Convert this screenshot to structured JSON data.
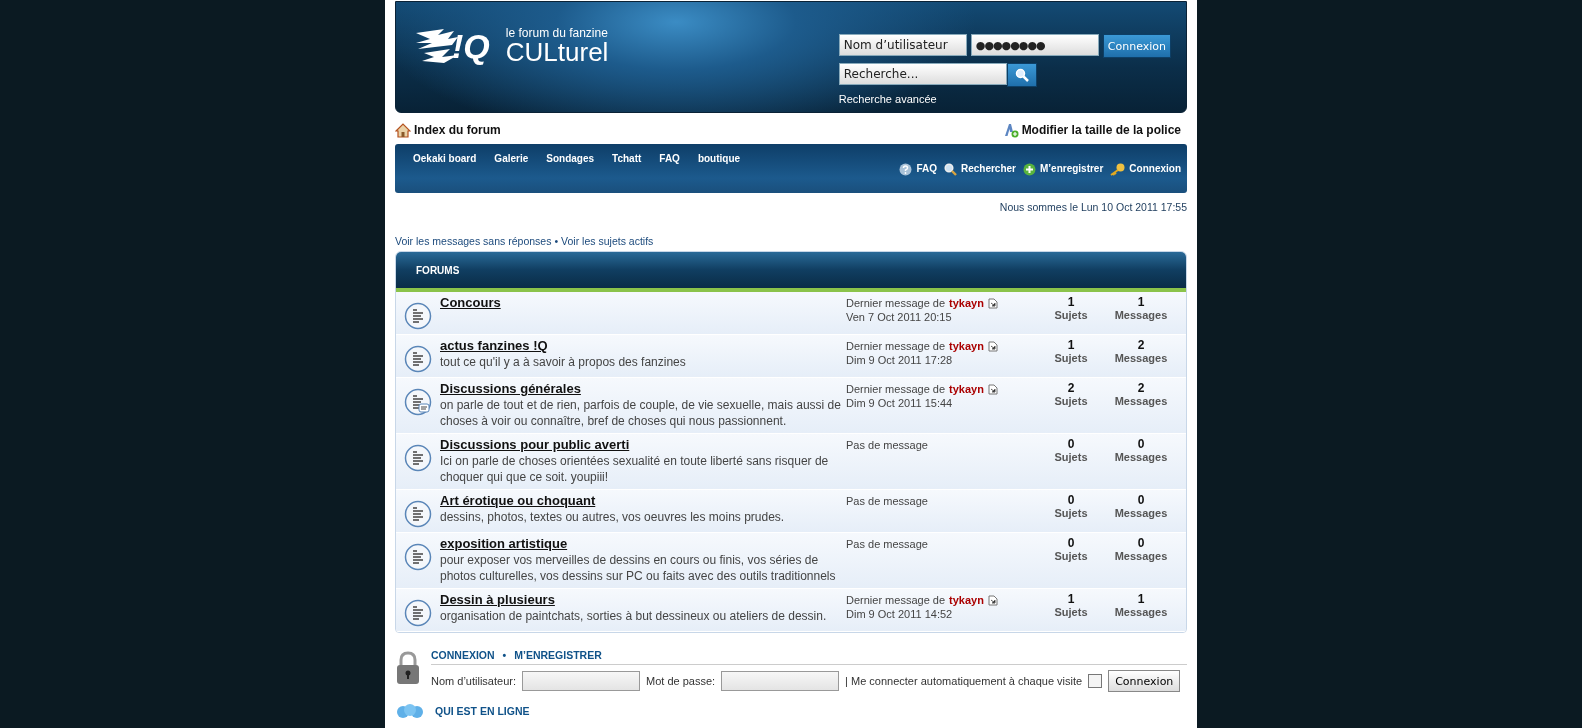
{
  "header": {
    "logo_mark": "!Q",
    "tagline": "le forum du fanzine",
    "site_name": "CULturel",
    "login": {
      "username_placeholder": "Nom d’utilisateur",
      "password_value": "●●●●●●●●",
      "button": "Connexion"
    },
    "search": {
      "placeholder": "Recherche...",
      "advanced_link": "Recherche avancée"
    }
  },
  "breadcrumb": {
    "index": "Index du forum",
    "font_size": "Modifier la taille de la police"
  },
  "navbar": {
    "links": [
      "Oekaki board",
      "Galerie",
      "Sondages",
      "Tchatt",
      "FAQ",
      "boutique"
    ],
    "actions": [
      {
        "kind": "help",
        "label": "FAQ"
      },
      {
        "kind": "search",
        "label": "Rechercher"
      },
      {
        "kind": "register",
        "label": "M’enregistrer"
      },
      {
        "kind": "login",
        "label": "Connexion"
      }
    ]
  },
  "date": "Nous sommes le Lun 10 Oct 2011 17:55",
  "quick_links": [
    {
      "label": "Voir les messages sans réponses"
    },
    {
      "label": "Voir les sujets actifs"
    }
  ],
  "quick_links_separator": "•",
  "forums": {
    "header": "FORUMS",
    "rows": [
      {
        "kind": "plain",
        "title": "Concours",
        "last": {
          "kind": "posted",
          "prefix": "Dernier message de",
          "author": "tykayn",
          "date": "Ven 7 Oct 2011 20:15"
        },
        "topics": "1",
        "posts": "1",
        "topics_label": "Sujets",
        "posts_label": "Messages"
      },
      {
        "kind": "plain",
        "title": "actus fanzines !Q",
        "description": "tout ce qu'il y a à savoir à propos des fanzines",
        "last": {
          "kind": "posted",
          "prefix": "Dernier message de",
          "author": "tykayn",
          "date": "Dim 9 Oct 2011 17:28"
        },
        "topics": "1",
        "posts": "2",
        "topics_label": "Sujets",
        "posts_label": "Messages"
      },
      {
        "kind": "subforum",
        "title": "Discussions générales",
        "description": "on parle de tout et de rien, parfois de couple, de vie sexuelle, mais aussi de choses à voir ou connaître, bref de choses qui nous passionnent.",
        "last": {
          "kind": "posted",
          "prefix": "Dernier message de",
          "author": "tykayn",
          "date": "Dim 9 Oct 2011 15:44"
        },
        "topics": "2",
        "posts": "2",
        "topics_label": "Sujets",
        "posts_label": "Messages"
      },
      {
        "kind": "plain",
        "title": "Discussions pour public averti",
        "description": "Ici on parle de choses orientées sexualité en toute liberté sans risquer de choquer qui que ce soit. youpiii!",
        "last": {
          "kind": "empty",
          "text": "Pas de message"
        },
        "topics": "0",
        "posts": "0",
        "topics_label": "Sujets",
        "posts_label": "Messages"
      },
      {
        "kind": "plain",
        "title": "Art érotique ou choquant",
        "description": "dessins, photos, textes ou autres, vos oeuvres les moins prudes.",
        "last": {
          "kind": "empty",
          "text": "Pas de message"
        },
        "topics": "0",
        "posts": "0",
        "topics_label": "Sujets",
        "posts_label": "Messages"
      },
      {
        "kind": "plain",
        "title": "exposition artistique",
        "description": "pour exposer vos merveilles de dessins en cours ou finis, vos séries de photos culturelles, vos dessins sur PC ou faits avec des outils traditionnels",
        "last": {
          "kind": "empty",
          "text": "Pas de message"
        },
        "topics": "0",
        "posts": "0",
        "topics_label": "Sujets",
        "posts_label": "Messages"
      },
      {
        "kind": "plain",
        "title": "Dessin à plusieurs",
        "description": "organisation de paintchats, sorties à but dessineux ou ateliers de dessin.",
        "last": {
          "kind": "posted",
          "prefix": "Dernier message de",
          "author": "tykayn",
          "date": "Dim 9 Oct 2011 14:52"
        },
        "topics": "1",
        "posts": "1",
        "topics_label": "Sujets",
        "posts_label": "Messages"
      }
    ]
  },
  "login_box": {
    "links": [
      "CONNEXION",
      "M’ENREGISTRER"
    ],
    "separator": "•",
    "username_label": "Nom d’utilisateur:",
    "password_label": "Mot de passe:",
    "remember_label": "| Me connecter automatiquement à chaque visite",
    "remember_checked": false,
    "button": "Connexion"
  },
  "online": {
    "title": "QUI EST EN LIGNE"
  }
}
